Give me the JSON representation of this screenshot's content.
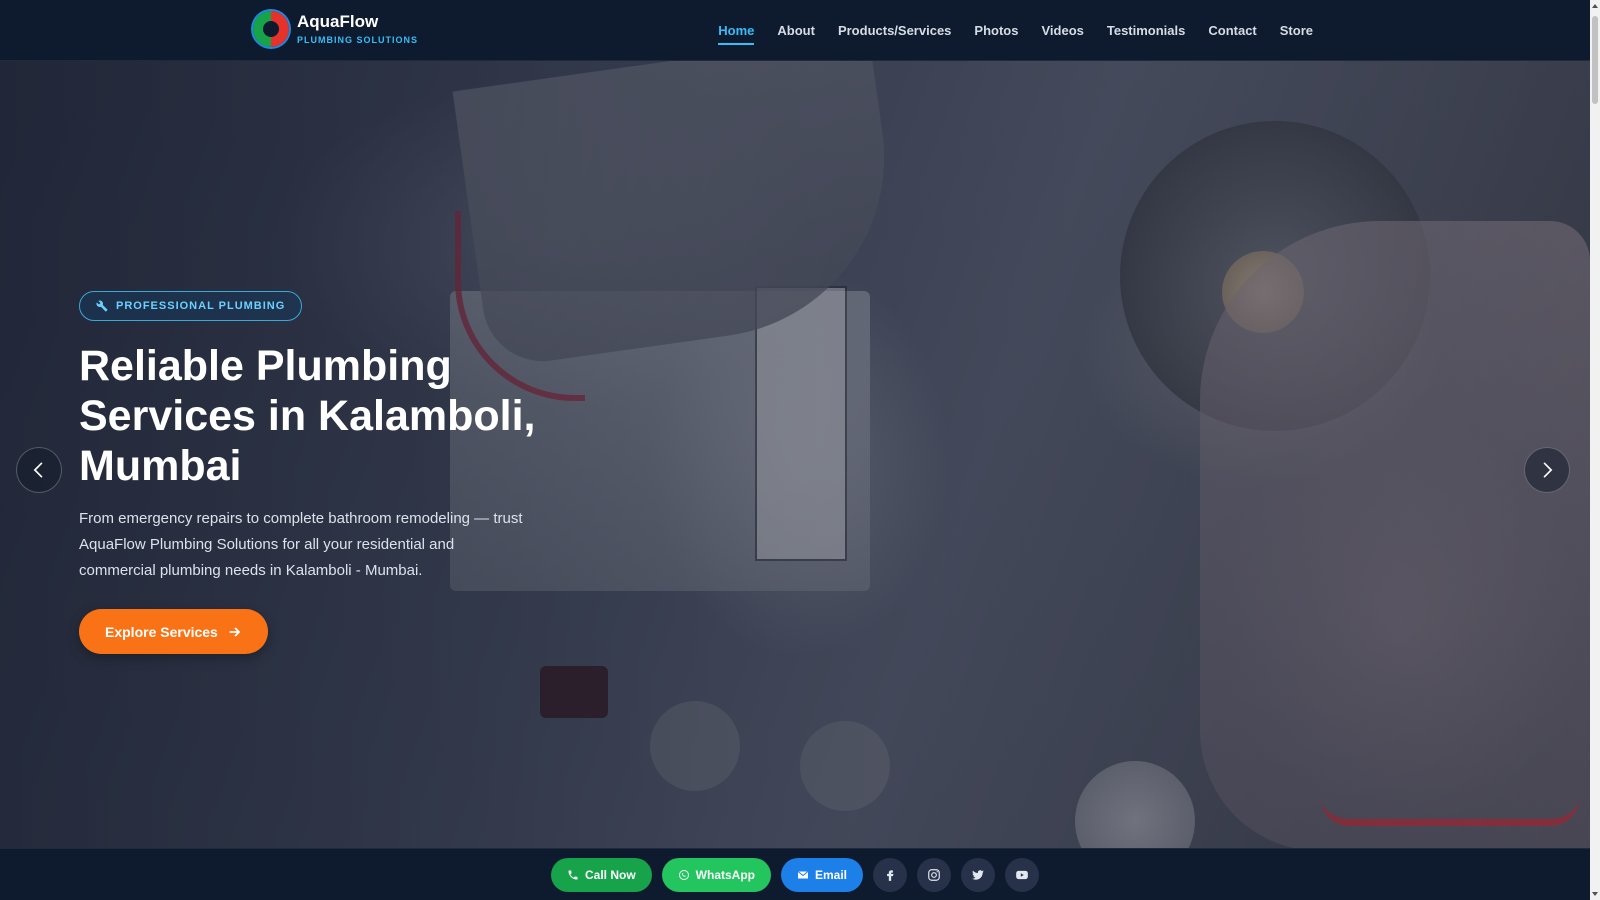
{
  "brand": {
    "name": "AquaFlow",
    "tagline": "PLUMBING SOLUTIONS"
  },
  "nav": {
    "items": [
      {
        "label": "Home",
        "active": true
      },
      {
        "label": "About"
      },
      {
        "label": "Products/Services"
      },
      {
        "label": "Photos"
      },
      {
        "label": "Videos"
      },
      {
        "label": "Testimonials"
      },
      {
        "label": "Contact"
      },
      {
        "label": "Store"
      }
    ]
  },
  "hero": {
    "badge": "PROFESSIONAL PLUMBING",
    "title_line1": "Reliable Plumbing",
    "title_line2": "Services in Kalamboli,",
    "title_line3": "Mumbai",
    "description": "From emergency repairs to complete bathroom remodeling — trust AquaFlow Plumbing Solutions for all your residential and commercial plumbing needs in Kalamboli - Mumbai.",
    "cta_label": "Explore Services"
  },
  "bottom_bar": {
    "call_label": "Call Now",
    "whatsapp_label": "WhatsApp",
    "email_label": "Email"
  },
  "colors": {
    "accent": "#38bdf8",
    "cta": "#f97316",
    "call": "#16a34a",
    "whatsapp": "#22c55e",
    "email": "#1d7fe8",
    "header_bg": "#0e1a2e"
  },
  "icons": {
    "badge": "wrench-icon",
    "cta": "arrow-right-icon",
    "prev": "chevron-left-icon",
    "next": "chevron-right-icon",
    "call": "phone-icon",
    "whatsapp": "whatsapp-icon",
    "email": "envelope-icon",
    "social": [
      "facebook-icon",
      "instagram-icon",
      "twitter-icon",
      "youtube-icon"
    ]
  }
}
